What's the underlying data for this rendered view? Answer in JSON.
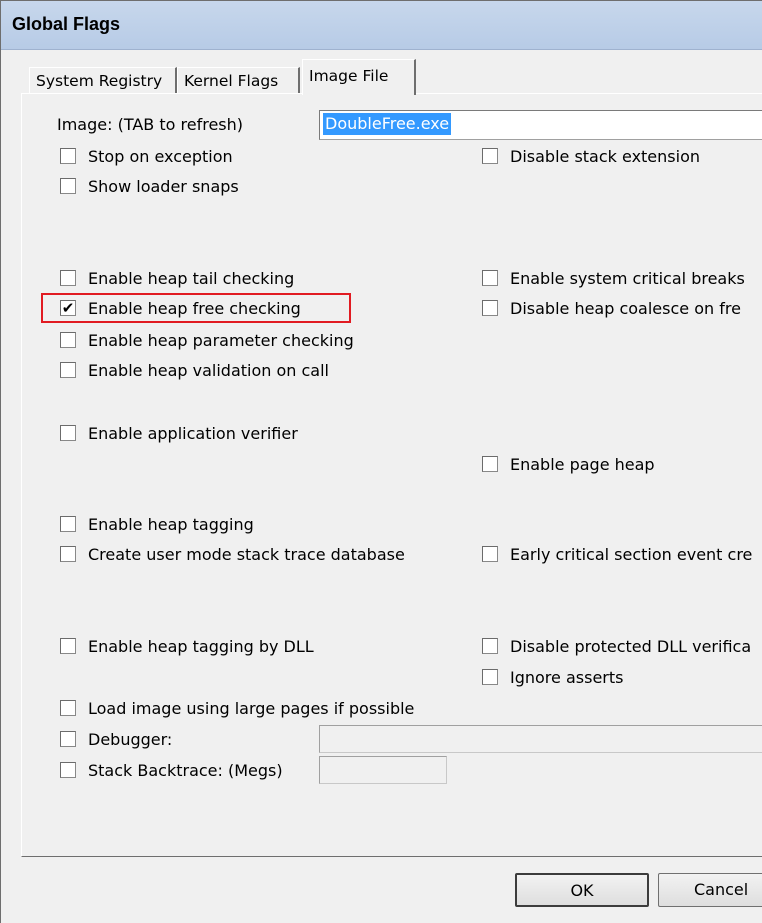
{
  "window": {
    "title": "Global Flags"
  },
  "tabs": [
    {
      "label": "System Registry",
      "active": false
    },
    {
      "label": "Kernel Flags",
      "active": false
    },
    {
      "label": "Image File",
      "active": true
    }
  ],
  "image": {
    "label": "Image: (TAB to refresh)",
    "value": "DoubleFree.exe"
  },
  "checkboxes": {
    "stop_on_exception": {
      "label": "Stop on exception",
      "checked": false
    },
    "show_loader_snaps": {
      "label": "Show loader snaps",
      "checked": false
    },
    "disable_stack_extension": {
      "label": "Disable stack extension",
      "checked": false
    },
    "heap_tail": {
      "label": "Enable heap tail checking",
      "checked": false
    },
    "heap_free": {
      "label": "Enable heap free checking",
      "checked": true
    },
    "heap_param": {
      "label": "Enable heap parameter checking",
      "checked": false
    },
    "heap_validation": {
      "label": "Enable heap validation on call",
      "checked": false
    },
    "sys_crit_breaks": {
      "label": "Enable system critical breaks",
      "checked": false
    },
    "heap_coalesce": {
      "label": "Disable heap coalesce on fre",
      "checked": false
    },
    "app_verifier": {
      "label": "Enable application verifier",
      "checked": false
    },
    "page_heap": {
      "label": "Enable page heap",
      "checked": false
    },
    "heap_tagging": {
      "label": "Enable heap tagging",
      "checked": false
    },
    "user_stack_trace": {
      "label": "Create user mode stack trace database",
      "checked": false
    },
    "early_crit_section": {
      "label": "Early critical section event cre",
      "checked": false
    },
    "heap_tagging_dll": {
      "label": "Enable heap tagging by DLL",
      "checked": false
    },
    "protected_dll": {
      "label": "Disable protected DLL verifica",
      "checked": false
    },
    "ignore_asserts": {
      "label": "Ignore asserts",
      "checked": false
    },
    "large_pages": {
      "label": "Load image using large pages if possible",
      "checked": false
    },
    "debugger": {
      "label": "Debugger:",
      "checked": false
    },
    "stack_backtrace": {
      "label": "Stack Backtrace: (Megs)",
      "checked": false
    }
  },
  "buttons": {
    "ok": "OK",
    "cancel": "Cancel"
  },
  "colors": {
    "highlight": "#e11b22",
    "selection": "#3399ff"
  }
}
